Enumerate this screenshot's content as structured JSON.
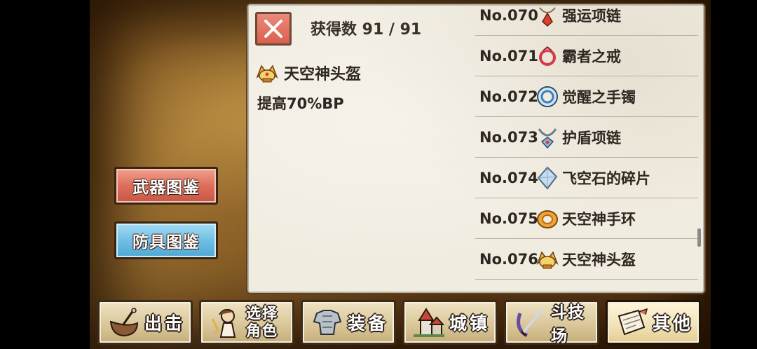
{
  "sidebar": {
    "weapon_label": "武器图鉴",
    "armor_label": "防具图鉴"
  },
  "panel": {
    "count_text": "获得数 91 / 91",
    "selected_name": "天空神头盔",
    "selected_desc": "提高70%BP"
  },
  "list": {
    "items": [
      {
        "num": "No.070",
        "name": "强运项链"
      },
      {
        "num": "No.071",
        "name": "霸者之戒"
      },
      {
        "num": "No.072",
        "name": "觉醒之手镯"
      },
      {
        "num": "No.073",
        "name": "护盾项链"
      },
      {
        "num": "No.074",
        "name": "飞空石的碎片"
      },
      {
        "num": "No.075",
        "name": "天空神手环"
      },
      {
        "num": "No.076",
        "name": "天空神头盔"
      }
    ]
  },
  "nav": {
    "sortie": "出击",
    "select_line1": "选择",
    "select_line2": "角色",
    "equip": "装备",
    "town": "城镇",
    "arena": "斗技场",
    "other": "其他"
  },
  "colors": {
    "weapon_button": "#dd6f5c",
    "armor_button": "#6fbfe4",
    "close_button": "#d9604d",
    "panel_bg": "#f1ece0"
  },
  "icons": {
    "close": "close-icon",
    "helmet": "helmet-icon",
    "necklace": "necklace-icon",
    "ring": "ring-icon",
    "bracelet": "bracelet-icon",
    "stone": "stone-shard-icon"
  }
}
